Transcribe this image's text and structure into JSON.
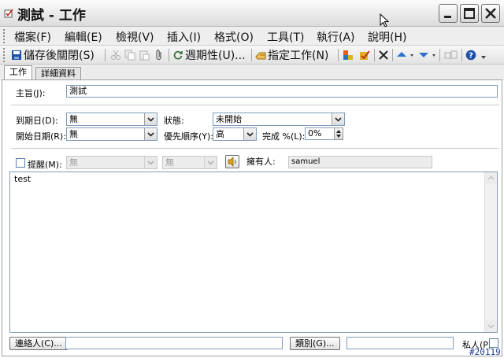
{
  "window": {
    "title": "測試 - 工作"
  },
  "menu": [
    "檔案(F)",
    "編輯(E)",
    "檢視(V)",
    "插入(I)",
    "格式(O)",
    "工具(T)",
    "執行(A)",
    "說明(H)"
  ],
  "toolbar": {
    "save_close": "儲存後關閉(S)",
    "recurrence": "週期性(U)...",
    "assign": "指定工作(N)"
  },
  "tabs": [
    {
      "label": "工作",
      "active": true
    },
    {
      "label": "詳細資料",
      "active": false
    }
  ],
  "form": {
    "subject_label": "主旨(J):",
    "subject_value": "測試",
    "due_label": "到期日(D):",
    "due_value": "無",
    "status_label": "狀態:",
    "status_value": "未開始",
    "start_label": "開始日期(R):",
    "start_value": "無",
    "priority_label": "優先順序(Y):",
    "priority_value": "高",
    "complete_label": "完成 %(L):",
    "complete_value": "0%",
    "reminder_label": "提醒(M):",
    "reminder_date": "無",
    "reminder_time": "無",
    "owner_label": "擁有人:",
    "owner_value": "samuel",
    "notes": "test"
  },
  "footer": {
    "contacts_button": "連絡人(C)...",
    "contacts_value": "",
    "categories_button": "類別(G)...",
    "categories_value": "",
    "private_label": "私人(P)"
  },
  "stamp": "#20119",
  "colors": {
    "accent_blue": "#1b4fa8",
    "input_border": "#7f9db9",
    "close_red": "#c9201a"
  },
  "icons": [
    "task-icon",
    "minimize-icon",
    "maximize-icon",
    "close-icon",
    "save-icon",
    "cut-icon",
    "copy-icon",
    "paste-icon",
    "attach-icon",
    "recurrence-icon",
    "assign-icon",
    "categorize-icon",
    "mark-complete-icon",
    "delete-icon",
    "up-arrow-icon",
    "down-arrow-icon",
    "address-book-icon",
    "help-icon",
    "reminder-sound-icon"
  ]
}
